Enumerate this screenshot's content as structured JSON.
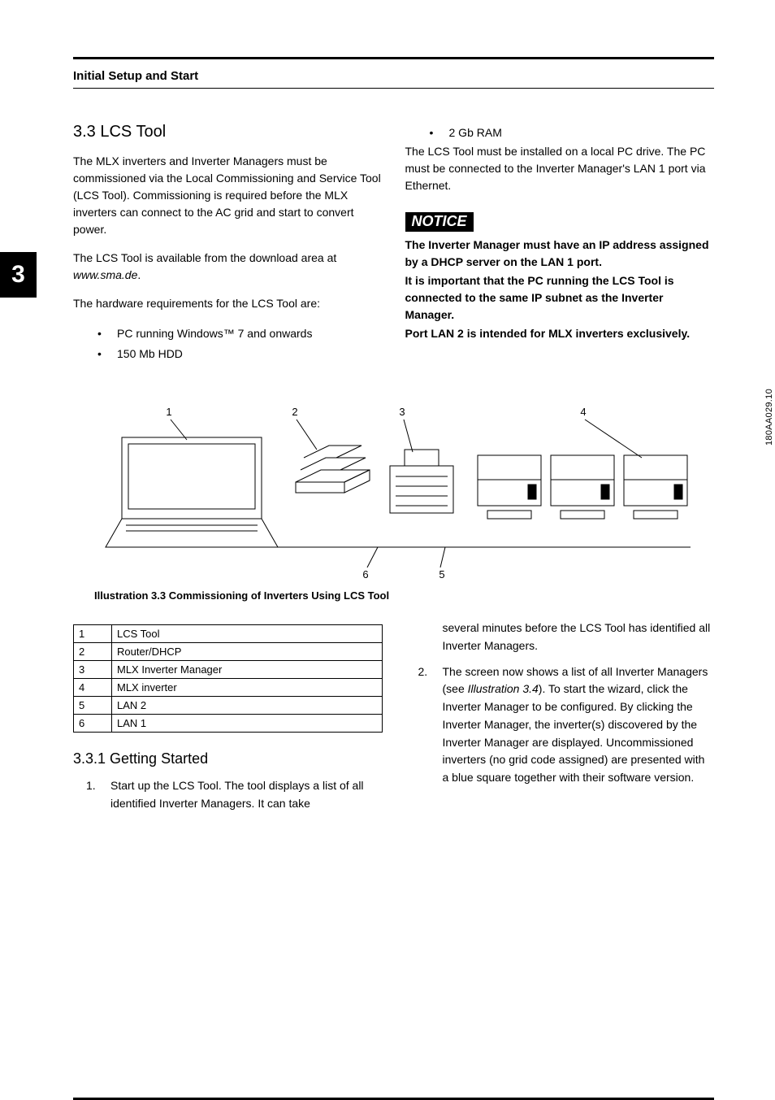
{
  "header": {
    "section_label": "Initial Setup and Start"
  },
  "chapter_tab": "3",
  "left": {
    "h2": "3.3  LCS Tool",
    "p1": "The MLX inverters and Inverter Managers must be commissioned via the Local Commissioning and Service Tool (LCS Tool). Commissioning is required before the MLX inverters can connect to the AC grid and start to convert power.",
    "p2a": "The LCS Tool is available from the download area at ",
    "p2_link": "www.sma.de",
    "p2b": ".",
    "p3": "The hardware requirements for the LCS Tool are:",
    "req": [
      "PC running Windows™ 7 and onwards",
      "150 Mb HDD"
    ]
  },
  "right": {
    "req_extra": [
      "2 Gb RAM"
    ],
    "p1": "The LCS Tool must be installed on a local PC drive. The PC must be connected to the Inverter Manager's LAN 1 port via Ethernet.",
    "notice_label": "NOTICE",
    "notice1": "The Inverter Manager must have an IP address assigned by a DHCP server on the LAN 1 port.",
    "notice2": "It is important that the PC running the LCS Tool is connected to the same IP subnet as the Inverter Manager.",
    "notice3": "Port LAN 2 is intended for MLX inverters exclusively."
  },
  "illustration": {
    "labels": {
      "1": "1",
      "2": "2",
      "3": "3",
      "4": "4",
      "5": "5",
      "6": "6"
    },
    "code": "180AA029.10",
    "caption": "Illustration 3.3 Commissioning of Inverters Using LCS Tool"
  },
  "legend": {
    "rows": [
      [
        "1",
        "LCS Tool"
      ],
      [
        "2",
        "Router/DHCP"
      ],
      [
        "3",
        "MLX Inverter Manager"
      ],
      [
        "4",
        "MLX inverter"
      ],
      [
        "5",
        "LAN 2"
      ],
      [
        "6",
        "LAN 1"
      ]
    ]
  },
  "lower": {
    "h3": "3.3.1 Getting Started",
    "step1_num": "1.",
    "step1": "Start up the LCS Tool. The tool displays a list of all identified Inverter Managers. It can take",
    "step1_cont": "several minutes before the LCS Tool has identified all Inverter Managers.",
    "step2_num": "2.",
    "step2a": "The screen now shows a list of all Inverter Managers (see ",
    "step2_ref": "Illustration 3.4",
    "step2b": "). To start the wizard, click the Inverter Manager to be configured. By clicking the Inverter Manager, the inverter(s) discovered by the Inverter Manager are displayed. Uncommissioned inverters (no grid code assigned) are presented with a blue square together with their software version."
  }
}
